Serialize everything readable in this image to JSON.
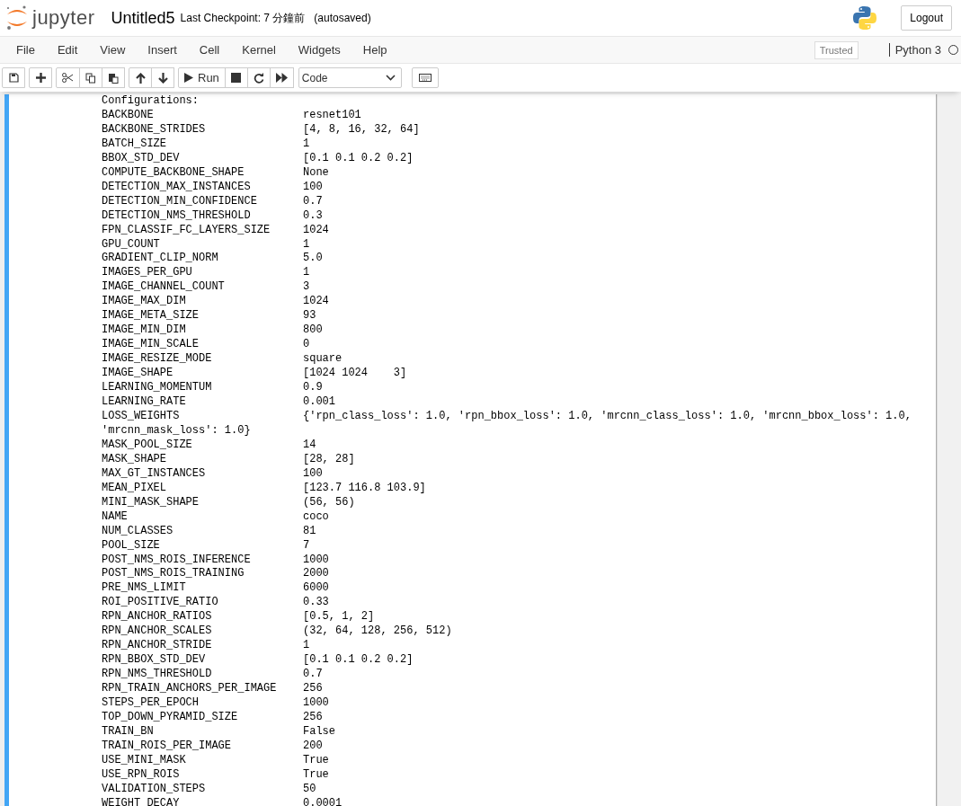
{
  "header": {
    "logo_text": "jupyter",
    "notebook_name": "Untitled5",
    "checkpoint": "Last Checkpoint: 7 分鐘前",
    "autosave": "(autosaved)",
    "logout": "Logout"
  },
  "menu": [
    "File",
    "Edit",
    "View",
    "Insert",
    "Cell",
    "Kernel",
    "Widgets",
    "Help"
  ],
  "trusted": "Trusted",
  "kernel": {
    "name": "Python 3",
    "busy": false
  },
  "toolbar": [
    {
      "kind": "save"
    },
    {
      "kind": "add"
    },
    {
      "kind": "cut"
    },
    {
      "kind": "copy"
    },
    {
      "kind": "paste"
    },
    {
      "kind": "up"
    },
    {
      "kind": "down"
    },
    {
      "kind": "run",
      "label": "Run"
    },
    {
      "kind": "stop"
    },
    {
      "kind": "restart"
    },
    {
      "kind": "fastforward"
    }
  ],
  "cell_type": "Code",
  "output": [
    {
      "kind": "heading",
      "text": "Configurations:"
    },
    {
      "kind": "pair",
      "key": "BACKBONE",
      "value": "resnet101"
    },
    {
      "kind": "pair",
      "key": "BACKBONE_STRIDES",
      "value": "[4, 8, 16, 32, 64]"
    },
    {
      "kind": "pair",
      "key": "BATCH_SIZE",
      "value": "1"
    },
    {
      "kind": "pair",
      "key": "BBOX_STD_DEV",
      "value": "[0.1 0.1 0.2 0.2]"
    },
    {
      "kind": "pair",
      "key": "COMPUTE_BACKBONE_SHAPE",
      "value": "None"
    },
    {
      "kind": "pair",
      "key": "DETECTION_MAX_INSTANCES",
      "value": "100"
    },
    {
      "kind": "pair",
      "key": "DETECTION_MIN_CONFIDENCE",
      "value": "0.7"
    },
    {
      "kind": "pair",
      "key": "DETECTION_NMS_THRESHOLD",
      "value": "0.3"
    },
    {
      "kind": "pair",
      "key": "FPN_CLASSIF_FC_LAYERS_SIZE",
      "value": "1024"
    },
    {
      "kind": "pair",
      "key": "GPU_COUNT",
      "value": "1"
    },
    {
      "kind": "pair",
      "key": "GRADIENT_CLIP_NORM",
      "value": "5.0"
    },
    {
      "kind": "pair",
      "key": "IMAGES_PER_GPU",
      "value": "1"
    },
    {
      "kind": "pair",
      "key": "IMAGE_CHANNEL_COUNT",
      "value": "3"
    },
    {
      "kind": "pair",
      "key": "IMAGE_MAX_DIM",
      "value": "1024"
    },
    {
      "kind": "pair",
      "key": "IMAGE_META_SIZE",
      "value": "93"
    },
    {
      "kind": "pair",
      "key": "IMAGE_MIN_DIM",
      "value": "800"
    },
    {
      "kind": "pair",
      "key": "IMAGE_MIN_SCALE",
      "value": "0"
    },
    {
      "kind": "pair",
      "key": "IMAGE_RESIZE_MODE",
      "value": "square"
    },
    {
      "kind": "pair",
      "key": "IMAGE_SHAPE",
      "value": "[1024 1024    3]"
    },
    {
      "kind": "pair",
      "key": "LEARNING_MOMENTUM",
      "value": "0.9"
    },
    {
      "kind": "pair",
      "key": "LEARNING_RATE",
      "value": "0.001"
    },
    {
      "kind": "pair",
      "key": "LOSS_WEIGHTS",
      "value": "{'rpn_class_loss': 1.0, 'rpn_bbox_loss': 1.0, 'mrcnn_class_loss': 1.0, 'mrcnn_bbox_loss': 1.0,"
    },
    {
      "kind": "continuation",
      "text": "'mrcnn_mask_loss': 1.0}"
    },
    {
      "kind": "pair",
      "key": "MASK_POOL_SIZE",
      "value": "14"
    },
    {
      "kind": "pair",
      "key": "MASK_SHAPE",
      "value": "[28, 28]"
    },
    {
      "kind": "pair",
      "key": "MAX_GT_INSTANCES",
      "value": "100"
    },
    {
      "kind": "pair",
      "key": "MEAN_PIXEL",
      "value": "[123.7 116.8 103.9]"
    },
    {
      "kind": "pair",
      "key": "MINI_MASK_SHAPE",
      "value": "(56, 56)"
    },
    {
      "kind": "pair",
      "key": "NAME",
      "value": "coco"
    },
    {
      "kind": "pair",
      "key": "NUM_CLASSES",
      "value": "81"
    },
    {
      "kind": "pair",
      "key": "POOL_SIZE",
      "value": "7"
    },
    {
      "kind": "pair",
      "key": "POST_NMS_ROIS_INFERENCE",
      "value": "1000"
    },
    {
      "kind": "pair",
      "key": "POST_NMS_ROIS_TRAINING",
      "value": "2000"
    },
    {
      "kind": "pair",
      "key": "PRE_NMS_LIMIT",
      "value": "6000"
    },
    {
      "kind": "pair",
      "key": "ROI_POSITIVE_RATIO",
      "value": "0.33"
    },
    {
      "kind": "pair",
      "key": "RPN_ANCHOR_RATIOS",
      "value": "[0.5, 1, 2]"
    },
    {
      "kind": "pair",
      "key": "RPN_ANCHOR_SCALES",
      "value": "(32, 64, 128, 256, 512)"
    },
    {
      "kind": "pair",
      "key": "RPN_ANCHOR_STRIDE",
      "value": "1"
    },
    {
      "kind": "pair",
      "key": "RPN_BBOX_STD_DEV",
      "value": "[0.1 0.1 0.2 0.2]"
    },
    {
      "kind": "pair",
      "key": "RPN_NMS_THRESHOLD",
      "value": "0.7"
    },
    {
      "kind": "pair",
      "key": "RPN_TRAIN_ANCHORS_PER_IMAGE",
      "value": "256"
    },
    {
      "kind": "pair",
      "key": "STEPS_PER_EPOCH",
      "value": "1000"
    },
    {
      "kind": "pair",
      "key": "TOP_DOWN_PYRAMID_SIZE",
      "value": "256"
    },
    {
      "kind": "pair",
      "key": "TRAIN_BN",
      "value": "False"
    },
    {
      "kind": "pair",
      "key": "TRAIN_ROIS_PER_IMAGE",
      "value": "200"
    },
    {
      "kind": "pair",
      "key": "USE_MINI_MASK",
      "value": "True"
    },
    {
      "kind": "pair",
      "key": "USE_RPN_ROIS",
      "value": "True"
    },
    {
      "kind": "pair",
      "key": "VALIDATION_STEPS",
      "value": "50"
    },
    {
      "kind": "pair",
      "key": "WEIGHT_DECAY",
      "value": "0.0001"
    }
  ]
}
